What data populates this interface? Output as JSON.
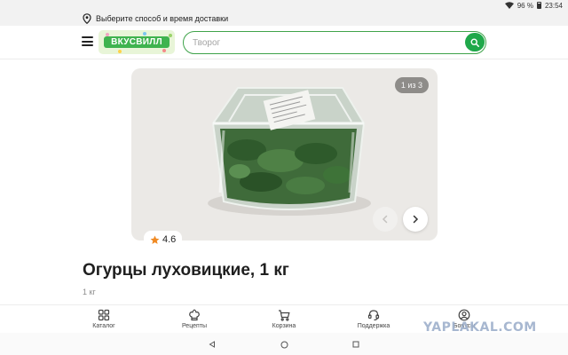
{
  "status_bar": {
    "battery": "96 %",
    "time": "23:54"
  },
  "delivery": {
    "text": "Выберите способ и время доставки"
  },
  "header": {
    "logo_text": "ВКУСВИЛЛ",
    "search_placeholder": "Творог"
  },
  "gallery": {
    "counter": "1 из 3"
  },
  "product": {
    "rating": "4.6",
    "title": "Огурцы луховицкие, 1 кг",
    "weight": "1 кг"
  },
  "nav": {
    "items": [
      {
        "label": "Каталог",
        "icon": "grid-icon"
      },
      {
        "label": "Рецепты",
        "icon": "chef-hat-icon"
      },
      {
        "label": "Корзина",
        "icon": "cart-icon"
      },
      {
        "label": "Поддержка",
        "icon": "headset-icon"
      },
      {
        "label": "Бонусы",
        "icon": "profile-icon"
      }
    ]
  },
  "watermark": "YAPLAKAL.COM",
  "colors": {
    "brand_green": "#1fa84a",
    "search_border": "#3fa34a",
    "star": "#f08a24"
  }
}
